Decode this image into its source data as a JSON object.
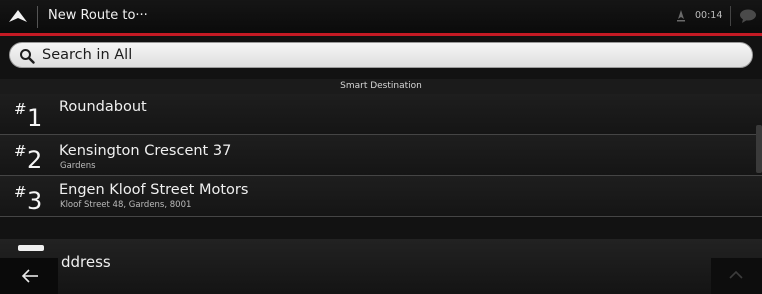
{
  "topbar": {
    "title": "New Route to···",
    "clock": "00:14",
    "icons": {
      "nav": "navigation-arrow-icon",
      "gps": "gps-signal-icon",
      "messages": "message-bubble-icon"
    },
    "accent_color": "#c41a24"
  },
  "search": {
    "placeholder": "Search in All",
    "icon": "search-icon"
  },
  "section": {
    "title": "Smart Destination"
  },
  "destinations": [
    {
      "rank_prefix": "#",
      "rank": "1",
      "title": "Roundabout",
      "subtitle": ""
    },
    {
      "rank_prefix": "#",
      "rank": "2",
      "title": "Kensington Crescent 37",
      "subtitle": "Gardens"
    },
    {
      "rank_prefix": "#",
      "rank": "3",
      "title": "Engen Kloof Street Motors",
      "subtitle": "Kloof Street 48, Gardens, 8001"
    }
  ],
  "address_item": {
    "label": "ddress",
    "icon": "address-book-icon"
  },
  "footer": {
    "back_icon": "back-arrow-icon",
    "up_icon": "chevron-up-icon"
  }
}
